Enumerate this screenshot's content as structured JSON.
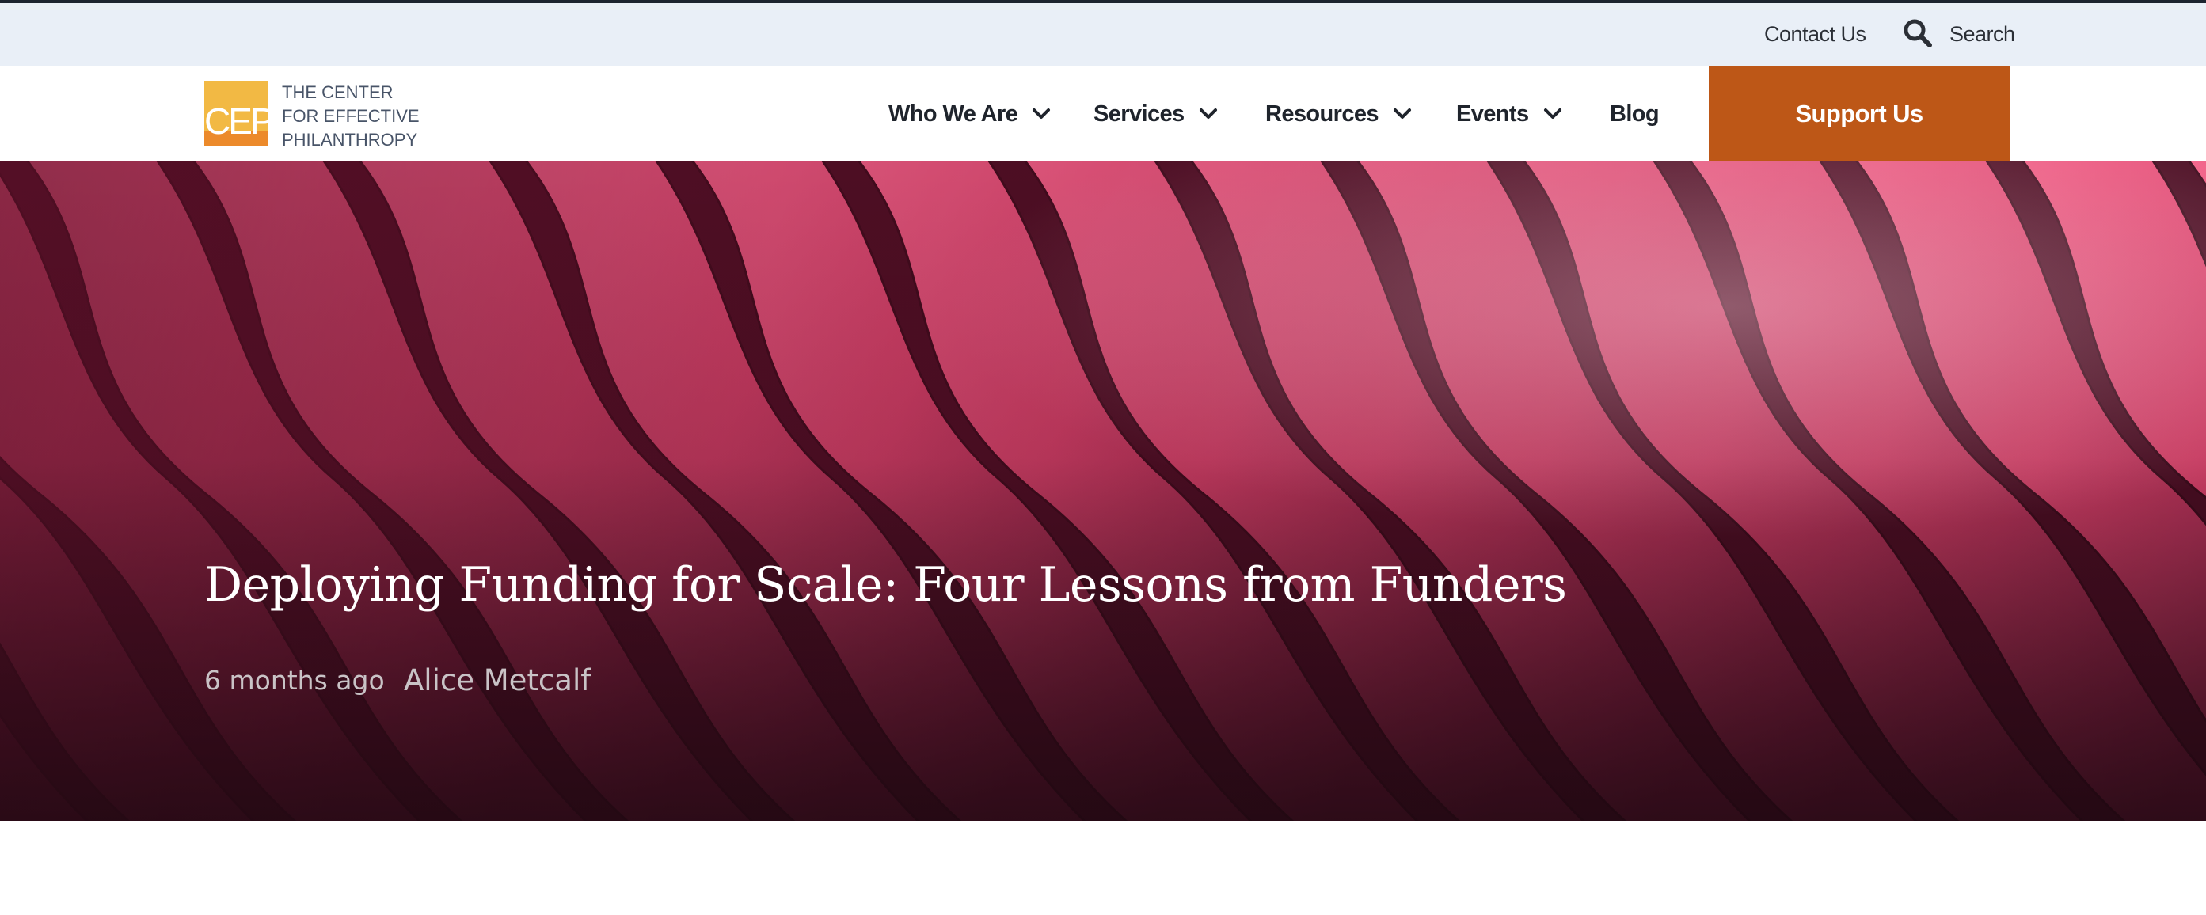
{
  "utility_bar": {
    "contact_label": "Contact Us",
    "search_label": "Search",
    "search_icon": "search-icon"
  },
  "brand": {
    "logo_mark": "CEP",
    "name_lines": [
      "THE CENTER",
      "FOR EFFECTIVE",
      "PHILANTHROPY"
    ],
    "logo_colors": {
      "top": "#f2b944",
      "bottom": "#ec8a2b"
    }
  },
  "nav": {
    "items": [
      {
        "label": "Who We Are",
        "has_dropdown": true
      },
      {
        "label": "Services",
        "has_dropdown": true
      },
      {
        "label": "Resources",
        "has_dropdown": true
      },
      {
        "label": "Events",
        "has_dropdown": true
      },
      {
        "label": "Blog",
        "has_dropdown": false
      }
    ],
    "cta_label": "Support Us",
    "cta_color": "#bd5717"
  },
  "hero": {
    "title": "Deploying Funding for Scale: Four Lessons from Funders",
    "date": "6 months ago",
    "author": "Alice Metcalf",
    "accent": "#e84a74"
  }
}
